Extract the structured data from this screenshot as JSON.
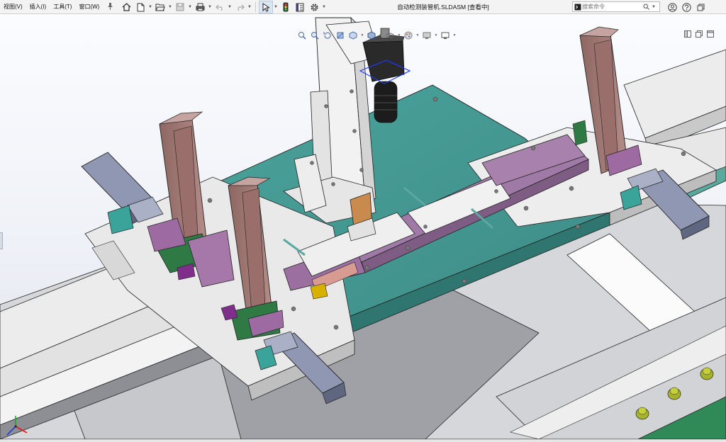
{
  "menu": {
    "items": [
      {
        "label": "视图(V)"
      },
      {
        "label": "插入(I)"
      },
      {
        "label": "工具(T)"
      },
      {
        "label": "窗口(W)"
      }
    ],
    "pin_icon": "pin-icon"
  },
  "toolbar": {
    "buttons": [
      "home-icon",
      "new-document-icon",
      "open-icon",
      "save-icon",
      "print-icon",
      "undo-icon",
      "redo-icon",
      "select-pointer-icon",
      "traffic-light-icon",
      "file-properties-icon",
      "options-gear-icon"
    ]
  },
  "document": {
    "title": "自动检测装管机.SLDASM [查看中]"
  },
  "search": {
    "placeholder": "搜索命令"
  },
  "right_icons": [
    "account-icon",
    "help-icon",
    "restore-window-icon"
  ],
  "heads_up_toolbar": [
    "zoom-to-fit-icon",
    "zoom-area-icon",
    "previous-view-icon",
    "section-view-icon",
    "view-orientation-icon",
    "display-style-icon",
    "hide-show-items-icon",
    "edit-appearance-icon",
    "apply-scene-icon",
    "view-settings-icon"
  ],
  "colors": {
    "base_plate": "#4b9a93",
    "frame": "#e6e6e6",
    "column": "#a47c79",
    "purple": "#9a6d9e",
    "slate": "#8f97b2",
    "accent_teal": "#3aa39a",
    "highlight_blue": "#1f3cff"
  }
}
